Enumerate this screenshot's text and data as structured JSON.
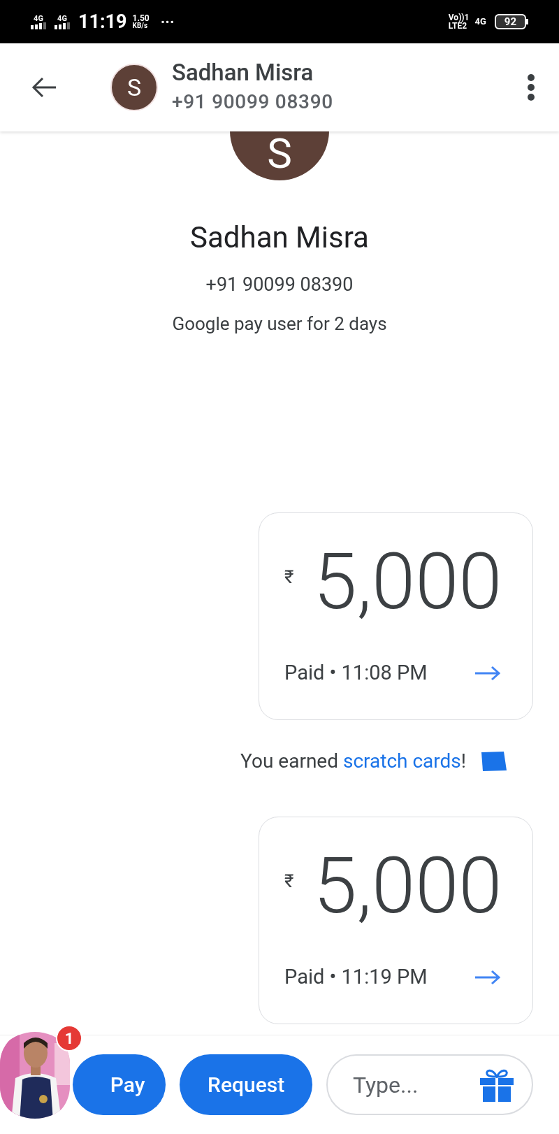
{
  "status_bar": {
    "sim1": "4G",
    "sim2": "4G",
    "time": "11:19",
    "speed": "1.50",
    "speed_unit": "KB/s",
    "more": "···",
    "volte": "Vo))1",
    "lte": "LTE2",
    "network": "4G",
    "battery": "92"
  },
  "header": {
    "name": "Sadhan Misra",
    "phone": "+91 90099 08390",
    "initial": "S"
  },
  "profile": {
    "initial": "S",
    "name": "Sadhan Misra",
    "phone": "+91 90099 08390",
    "since": "Google pay user for 2 days"
  },
  "payments": [
    {
      "currency": "₹",
      "amount": "5,000",
      "status": "Paid",
      "separator": "•",
      "time": "11:08 PM"
    },
    {
      "currency": "₹",
      "amount": "5,000",
      "status": "Paid",
      "separator": "•",
      "time": "11:19 PM"
    }
  ],
  "reward": {
    "prefix": "You earned ",
    "link": "scratch cards",
    "suffix": "!"
  },
  "chat_head": {
    "kind": "picture",
    "badge": "1"
  },
  "composer": {
    "buttons": [
      "Pay",
      "Request"
    ],
    "placeholder": "Type..."
  }
}
